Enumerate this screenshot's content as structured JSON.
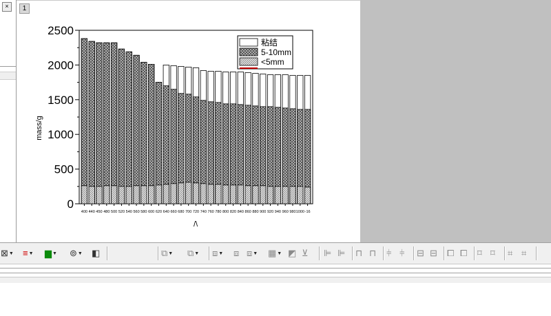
{
  "window": {
    "page_tab_label": "1",
    "close_glyph": "×"
  },
  "colors": {
    "grey_area": "#c0c0c0",
    "toolbar_bg": "#f0f0f0",
    "legend_red": "#c00000"
  },
  "toolbar": {
    "icons": [
      "scatter-icon",
      "line-color-icon",
      "bar-icon",
      "polar-icon",
      "import-icon",
      "layer-icon",
      "layer-icon",
      "group-icon",
      "group-icon",
      "grid-icon",
      "merge-icon",
      "shape-icon",
      "align-left-icon",
      "align-right-icon",
      "align-top-icon",
      "align-bottom-icon",
      "align-center-icon",
      "align-middle-icon",
      "resize-icon",
      "resize-icon",
      "front-icon",
      "back-icon",
      "zoom-icon",
      "zoom-icon",
      "frame-icon",
      "frame-icon"
    ]
  },
  "chart_data": {
    "type": "bar",
    "title": "",
    "xlabel": "/\\",
    "ylabel": "mass/g",
    "ylim": [
      0,
      2500
    ],
    "yticks": [
      0,
      500,
      1000,
      1500,
      2000,
      2500
    ],
    "grid": false,
    "legend_placement": "top-right",
    "categories": [
      "400",
      "440",
      "450",
      "480",
      "500",
      "520",
      "540",
      "560",
      "580",
      "600",
      "620",
      "640",
      "660",
      "680",
      "700",
      "720",
      "740",
      "760",
      "780",
      "800",
      "820",
      "840",
      "860",
      "880",
      "900",
      "920",
      "940",
      "960",
      "980",
      "1000",
      "-16"
    ],
    "series": [
      {
        "name": "粘结",
        "values": [
          2380,
          2340,
          2320,
          2320,
          2320,
          2230,
          2190,
          2140,
          2040,
          2010,
          1750,
          2000,
          1990,
          1980,
          1970,
          1960,
          1920,
          1910,
          1910,
          1900,
          1900,
          1900,
          1890,
          1880,
          1870,
          1860,
          1860,
          1860,
          1850,
          1850,
          1850
        ],
        "pattern": "white"
      },
      {
        "name": "5-10mm",
        "values": [
          2380,
          2340,
          2320,
          2320,
          2320,
          2230,
          2190,
          2140,
          2040,
          2010,
          1750,
          1700,
          1650,
          1590,
          1580,
          1540,
          1490,
          1470,
          1460,
          1440,
          1440,
          1430,
          1420,
          1410,
          1400,
          1400,
          1390,
          1380,
          1370,
          1360,
          1360
        ],
        "pattern": "crosshatch"
      },
      {
        "name": "<5mm",
        "values": [
          260,
          250,
          250,
          260,
          260,
          250,
          250,
          260,
          260,
          260,
          270,
          280,
          290,
          300,
          310,
          300,
          290,
          280,
          280,
          270,
          270,
          270,
          260,
          260,
          260,
          250,
          250,
          250,
          250,
          250,
          240
        ],
        "pattern": "dots"
      }
    ]
  }
}
